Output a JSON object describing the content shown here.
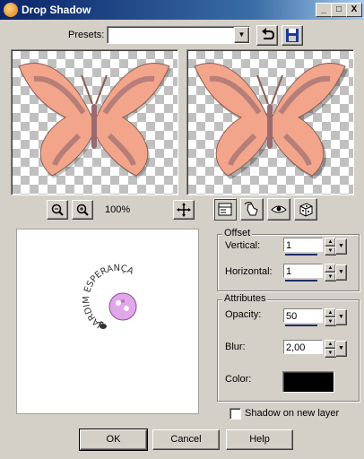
{
  "window": {
    "title": "Drop Shadow",
    "min_label": "_",
    "max_label": "□",
    "close_label": "X"
  },
  "presets": {
    "label": "Presets:",
    "value": ""
  },
  "zoom": {
    "level": "100%"
  },
  "offset": {
    "group_label": "Offset",
    "vertical_label": "Vertical:",
    "vertical_value": "1",
    "horizontal_label": "Horizontal:",
    "horizontal_value": "1"
  },
  "attributes": {
    "group_label": "Attributes",
    "opacity_label": "Opacity:",
    "opacity_value": "50",
    "blur_label": "Blur:",
    "blur_value": "2,00",
    "color_label": "Color:",
    "color_hex": "#000000"
  },
  "shadow_new_layer": {
    "label": "Shadow on new layer",
    "checked": false
  },
  "buttons": {
    "ok": "OK",
    "cancel": "Cancel",
    "help": "Help"
  },
  "preview_stamp": {
    "top_text": "JARDIM ESPERANÇA"
  },
  "colors": {
    "butterfly": "#f2a58a",
    "title_start": "#0a246a",
    "title_end": "#a6caf0"
  }
}
